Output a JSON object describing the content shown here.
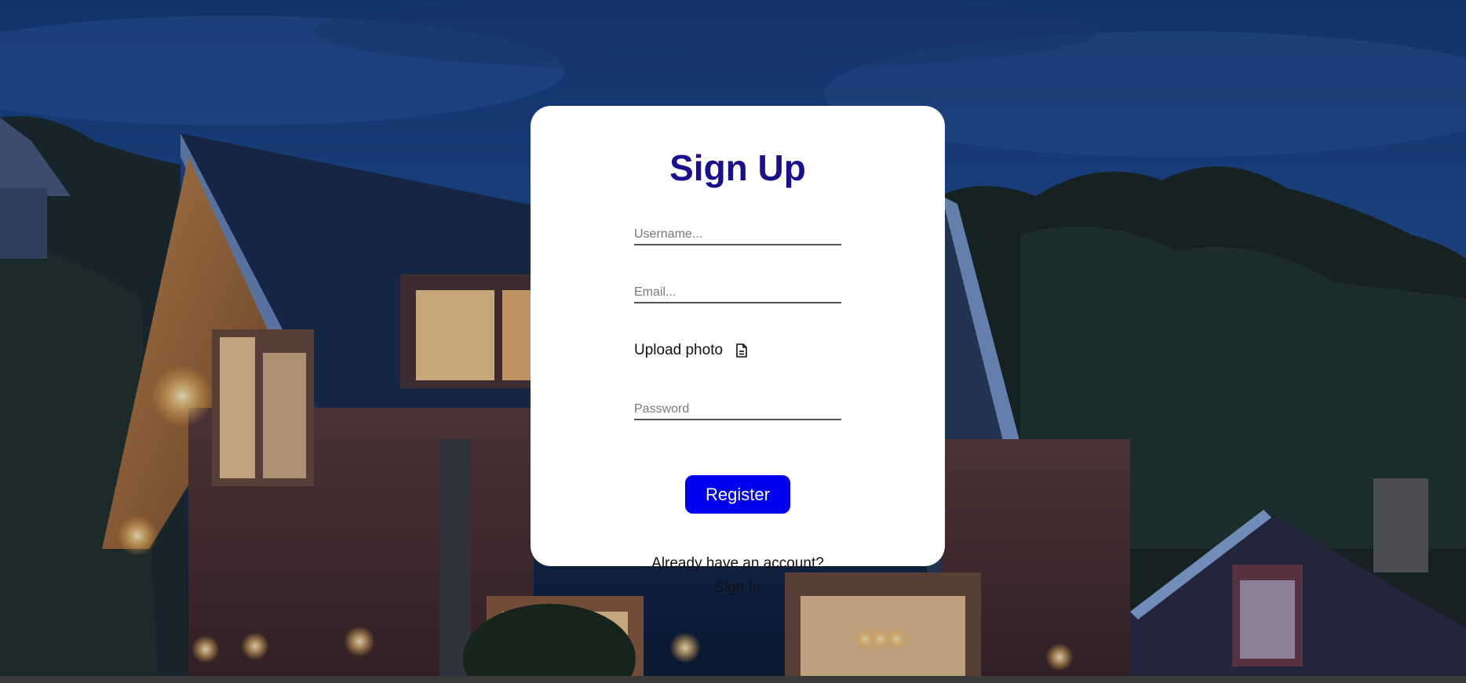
{
  "signup": {
    "title": "Sign Up",
    "username_placeholder": "Username...",
    "email_placeholder": "Email...",
    "upload_label": "Upload photo",
    "upload_icon": "file-icon",
    "password_placeholder": "Password",
    "register_label": "Register",
    "already_text": "Already have an account?",
    "signin_label": "Sign In"
  },
  "colors": {
    "title": "#1a0f8c",
    "button": "#0000f0",
    "card": "#ffffff"
  }
}
